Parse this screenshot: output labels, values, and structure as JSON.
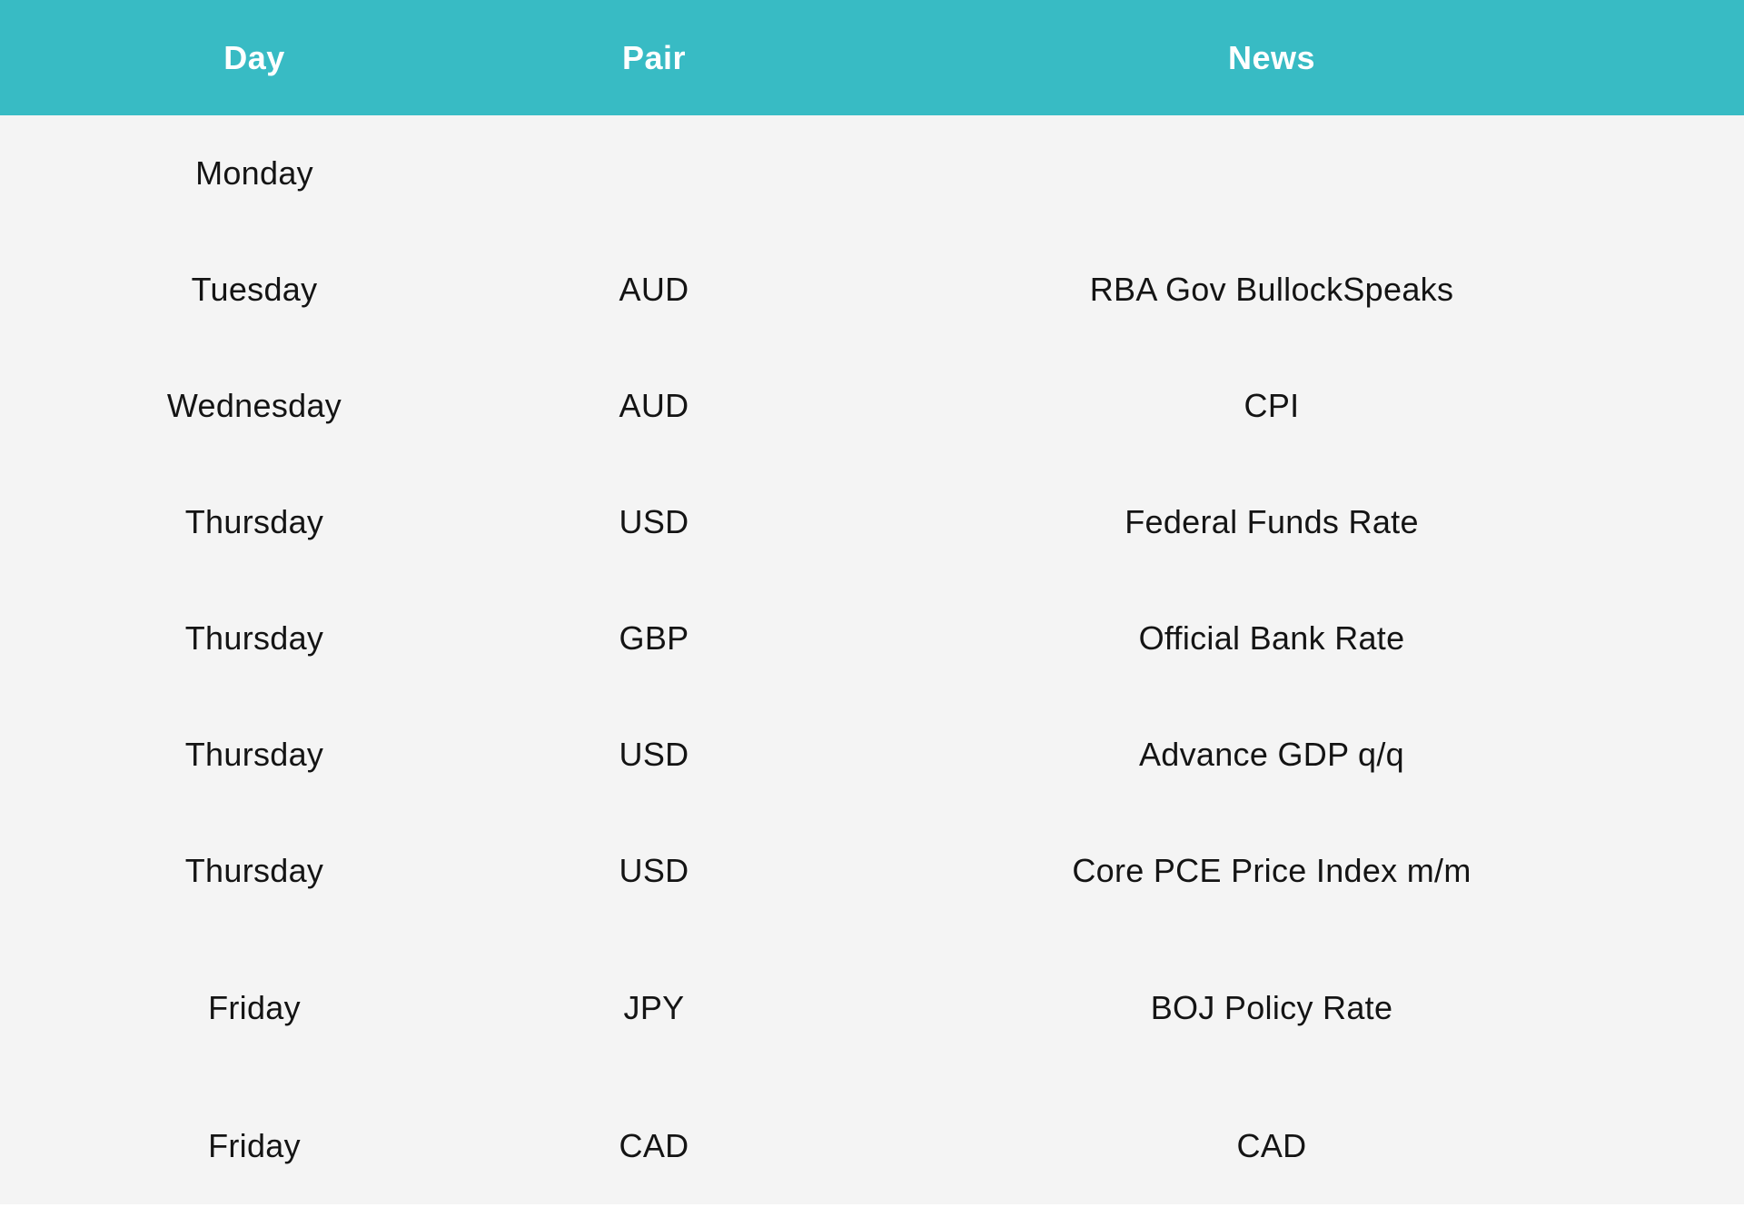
{
  "table": {
    "headers": {
      "day": "Day",
      "pair": "Pair",
      "news": "News"
    },
    "rows": [
      {
        "day": "Monday",
        "pair": "",
        "news": ""
      },
      {
        "day": "Tuesday",
        "pair": "AUD",
        "news": "RBA Gov BullockSpeaks"
      },
      {
        "day": "Wednesday",
        "pair": "AUD",
        "news": "CPI"
      },
      {
        "day": "Thursday",
        "pair": "USD",
        "news": "Federal Funds Rate"
      },
      {
        "day": "Thursday",
        "pair": "GBP",
        "news": "Official Bank Rate"
      },
      {
        "day": "Thursday",
        "pair": "USD",
        "news": "Advance GDP q/q"
      },
      {
        "day": "Thursday",
        "pair": "USD",
        "news": "Core PCE Price Index m/m"
      },
      {
        "day": "Friday",
        "pair": "JPY",
        "news": "BOJ Policy Rate"
      },
      {
        "day": "Friday",
        "pair": "CAD",
        "news": "CAD"
      }
    ]
  },
  "colors": {
    "header_bg": "#38bbc4",
    "header_text": "#ffffff",
    "body_bg": "#f4f4f4",
    "body_text": "#141414"
  }
}
